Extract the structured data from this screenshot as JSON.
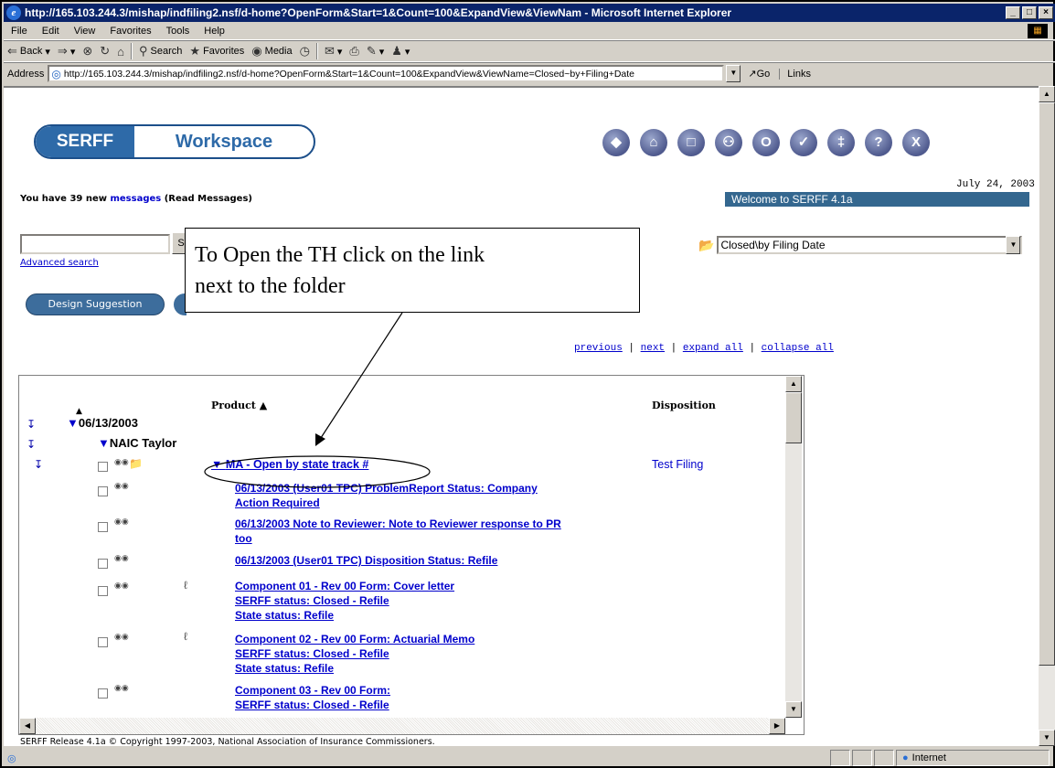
{
  "window": {
    "title": "http://165.103.244.3/mishap/indfiling2.nsf/d-home?OpenForm&Start=1&Count=100&ExpandView&ViewNam - Microsoft Internet Explorer",
    "min": "_",
    "max": "□",
    "close": "×"
  },
  "menu": [
    "File",
    "Edit",
    "View",
    "Favorites",
    "Tools",
    "Help"
  ],
  "toolbar": {
    "back": "Back",
    "search": "Search",
    "favorites": "Favorites",
    "media": "Media"
  },
  "address": {
    "label": "Address",
    "url": "http://165.103.244.3/mishap/indfiling2.nsf/d-home?OpenForm&Start=1&Count=100&ExpandView&ViewName=Closed~by+Filing+Date",
    "go": "Go",
    "links": "Links"
  },
  "logo": {
    "left": "SERFF",
    "right": "Workspace"
  },
  "nav_icons": [
    "shield-icon",
    "home-icon",
    "document-icon",
    "people-icon",
    "ring-icon",
    "check-icon",
    "tower-icon",
    "help-icon",
    "exit-icon"
  ],
  "nav_glyphs": [
    "◆",
    "⌂",
    "□",
    "⚇",
    "O",
    "✓",
    "‡",
    "?",
    "X"
  ],
  "date": "July 24, 2003",
  "welcome": "Welcome to SERFF 4.1a",
  "messages": {
    "prefix": "You have 39 new ",
    "link": "messages",
    "suffix": " (Read Messages)"
  },
  "search": {
    "value": "",
    "button": "S",
    "advanced": "Advanced search"
  },
  "design_button": "Design Suggestion",
  "view_select": {
    "value": "Closed\\by Filing Date"
  },
  "pager": {
    "previous": "previous",
    "next": "next",
    "expand_all": "expand all",
    "collapse_all": "collapse all",
    "sep": " | "
  },
  "callout": {
    "line1": "To Open the TH click on the link",
    "line2": "next to the folder"
  },
  "table": {
    "col_product": "Product ▲",
    "col_disposition": "Disposition",
    "col_sort": "▲",
    "date_group": "06/13/2003",
    "company_group": "NAIC Taylor",
    "filing_link": "MA - Open by state track #",
    "filing_disposition": "Test Filing",
    "rows": [
      {
        "line1": "06/13/2003 (User01 TPC) ProblemReport Status: Company",
        "line2": "Action Required"
      },
      {
        "line1": "06/13/2003 Note to Reviewer: Note to Reviewer response to PR",
        "line2": "too"
      },
      {
        "line1": "06/13/2003 (User01 TPC) Disposition Status: Refile"
      },
      {
        "line1": "Component 01 - Rev 00 Form: Cover letter",
        "line2": "SERFF status: Closed - Refile",
        "line3": "State status: Refile"
      },
      {
        "line1": "Component 02 - Rev 00 Form: Actuarial Memo",
        "line2": "SERFF status: Closed - Refile",
        "line3": "State status: Refile"
      },
      {
        "line1": "Component 03 - Rev 00 Form:",
        "line2": "SERFF status: Closed - Refile"
      }
    ]
  },
  "footer": "SERFF Release 4.1a © Copyright 1997-2003, National Association of Insurance Commissioners.",
  "status": {
    "zone": "Internet"
  }
}
